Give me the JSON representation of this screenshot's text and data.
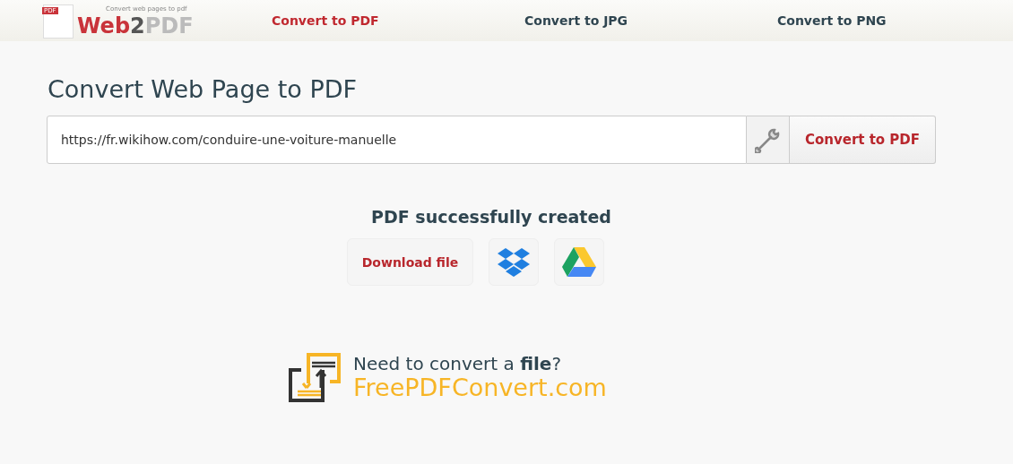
{
  "header": {
    "logo": {
      "badge": "PDF",
      "tagline": "Convert web pages to pdf",
      "name_parts": [
        {
          "text": "Web",
          "kind": "accent"
        },
        {
          "text": "2",
          "kind": "dark"
        },
        {
          "text": "PDF",
          "kind": "light"
        }
      ]
    },
    "nav": [
      {
        "label": "Convert to PDF",
        "selected": true
      },
      {
        "label": "Convert to JPG",
        "selected": false
      },
      {
        "label": "Convert to PNG",
        "selected": false
      }
    ]
  },
  "title": "Convert Web Page to PDF",
  "url_field": {
    "value": "https://fr.wikihow.com/conduire-une-voiture-manuelle"
  },
  "convert_button": "Convert to PDF",
  "result": {
    "message": "PDF successfully created",
    "download_button": "Download file",
    "share": [
      {
        "kind": "dropbox"
      },
      {
        "kind": "drive"
      }
    ]
  },
  "promo": {
    "line": "Need to convert a **file**?",
    "link": "FreePDFConvert.com"
  }
}
